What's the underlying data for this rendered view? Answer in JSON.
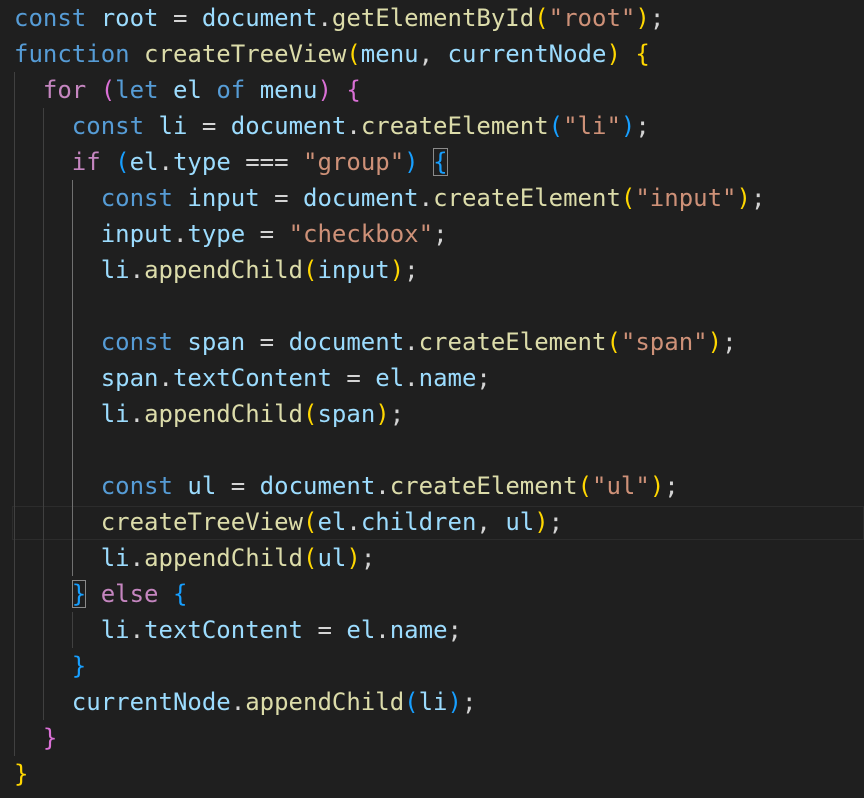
{
  "editor": {
    "language": "javascript",
    "colors": {
      "background": "#1f1f1f",
      "keyword": "#569cd6",
      "control": "#c586c0",
      "variable": "#9cdcfe",
      "function": "#dcdcaa",
      "string": "#ce9178",
      "plain": "#d4d4d4",
      "bracket_level_1": "#ffd700",
      "bracket_level_2": "#da70d6",
      "bracket_level_3": "#179fff"
    },
    "highlighted_line": 15,
    "lines": [
      {
        "tokens": [
          {
            "t": "const",
            "c": "keyword"
          },
          {
            "t": " ",
            "c": "plain"
          },
          {
            "t": "root",
            "c": "variable"
          },
          {
            "t": " = ",
            "c": "plain"
          },
          {
            "t": "document",
            "c": "variable"
          },
          {
            "t": ".",
            "c": "plain"
          },
          {
            "t": "getElementById",
            "c": "function"
          },
          {
            "t": "(",
            "c": "bracket_level_1"
          },
          {
            "t": "\"root\"",
            "c": "string"
          },
          {
            "t": ")",
            "c": "bracket_level_1"
          },
          {
            "t": ";",
            "c": "plain"
          }
        ]
      },
      {
        "tokens": [
          {
            "t": "function",
            "c": "keyword"
          },
          {
            "t": " ",
            "c": "plain"
          },
          {
            "t": "createTreeView",
            "c": "function"
          },
          {
            "t": "(",
            "c": "bracket_level_1"
          },
          {
            "t": "menu",
            "c": "variable"
          },
          {
            "t": ", ",
            "c": "plain"
          },
          {
            "t": "currentNode",
            "c": "variable"
          },
          {
            "t": ")",
            "c": "bracket_level_1"
          },
          {
            "t": " ",
            "c": "plain"
          },
          {
            "t": "{",
            "c": "bracket_level_1"
          }
        ]
      },
      {
        "tokens": [
          {
            "t": "  ",
            "c": "plain"
          },
          {
            "t": "for",
            "c": "control"
          },
          {
            "t": " ",
            "c": "plain"
          },
          {
            "t": "(",
            "c": "bracket_level_2"
          },
          {
            "t": "let",
            "c": "keyword"
          },
          {
            "t": " ",
            "c": "plain"
          },
          {
            "t": "el",
            "c": "variable"
          },
          {
            "t": " ",
            "c": "plain"
          },
          {
            "t": "of",
            "c": "keyword"
          },
          {
            "t": " ",
            "c": "plain"
          },
          {
            "t": "menu",
            "c": "variable"
          },
          {
            "t": ")",
            "c": "bracket_level_2"
          },
          {
            "t": " ",
            "c": "plain"
          },
          {
            "t": "{",
            "c": "bracket_level_2"
          }
        ]
      },
      {
        "tokens": [
          {
            "t": "    ",
            "c": "plain"
          },
          {
            "t": "const",
            "c": "keyword"
          },
          {
            "t": " ",
            "c": "plain"
          },
          {
            "t": "li",
            "c": "variable"
          },
          {
            "t": " = ",
            "c": "plain"
          },
          {
            "t": "document",
            "c": "variable"
          },
          {
            "t": ".",
            "c": "plain"
          },
          {
            "t": "createElement",
            "c": "function"
          },
          {
            "t": "(",
            "c": "bracket_level_3"
          },
          {
            "t": "\"li\"",
            "c": "string"
          },
          {
            "t": ")",
            "c": "bracket_level_3"
          },
          {
            "t": ";",
            "c": "plain"
          }
        ]
      },
      {
        "tokens": [
          {
            "t": "    ",
            "c": "plain"
          },
          {
            "t": "if",
            "c": "control"
          },
          {
            "t": " ",
            "c": "plain"
          },
          {
            "t": "(",
            "c": "bracket_level_3"
          },
          {
            "t": "el",
            "c": "variable"
          },
          {
            "t": ".",
            "c": "plain"
          },
          {
            "t": "type",
            "c": "variable"
          },
          {
            "t": " === ",
            "c": "plain"
          },
          {
            "t": "\"group\"",
            "c": "string"
          },
          {
            "t": ")",
            "c": "bracket_level_3"
          },
          {
            "t": " ",
            "c": "plain"
          },
          {
            "t": "{",
            "c": "bracket_level_3",
            "box": true
          }
        ]
      },
      {
        "tokens": [
          {
            "t": "      ",
            "c": "plain"
          },
          {
            "t": "const",
            "c": "keyword"
          },
          {
            "t": " ",
            "c": "plain"
          },
          {
            "t": "input",
            "c": "variable"
          },
          {
            "t": " = ",
            "c": "plain"
          },
          {
            "t": "document",
            "c": "variable"
          },
          {
            "t": ".",
            "c": "plain"
          },
          {
            "t": "createElement",
            "c": "function"
          },
          {
            "t": "(",
            "c": "bracket_level_1"
          },
          {
            "t": "\"input\"",
            "c": "string"
          },
          {
            "t": ")",
            "c": "bracket_level_1"
          },
          {
            "t": ";",
            "c": "plain"
          }
        ]
      },
      {
        "tokens": [
          {
            "t": "      ",
            "c": "plain"
          },
          {
            "t": "input",
            "c": "variable"
          },
          {
            "t": ".",
            "c": "plain"
          },
          {
            "t": "type",
            "c": "variable"
          },
          {
            "t": " = ",
            "c": "plain"
          },
          {
            "t": "\"checkbox\"",
            "c": "string"
          },
          {
            "t": ";",
            "c": "plain"
          }
        ]
      },
      {
        "tokens": [
          {
            "t": "      ",
            "c": "plain"
          },
          {
            "t": "li",
            "c": "variable"
          },
          {
            "t": ".",
            "c": "plain"
          },
          {
            "t": "appendChild",
            "c": "function"
          },
          {
            "t": "(",
            "c": "bracket_level_1"
          },
          {
            "t": "input",
            "c": "variable"
          },
          {
            "t": ")",
            "c": "bracket_level_1"
          },
          {
            "t": ";",
            "c": "plain"
          }
        ]
      },
      {
        "tokens": []
      },
      {
        "tokens": [
          {
            "t": "      ",
            "c": "plain"
          },
          {
            "t": "const",
            "c": "keyword"
          },
          {
            "t": " ",
            "c": "plain"
          },
          {
            "t": "span",
            "c": "variable"
          },
          {
            "t": " = ",
            "c": "plain"
          },
          {
            "t": "document",
            "c": "variable"
          },
          {
            "t": ".",
            "c": "plain"
          },
          {
            "t": "createElement",
            "c": "function"
          },
          {
            "t": "(",
            "c": "bracket_level_1"
          },
          {
            "t": "\"span\"",
            "c": "string"
          },
          {
            "t": ")",
            "c": "bracket_level_1"
          },
          {
            "t": ";",
            "c": "plain"
          }
        ]
      },
      {
        "tokens": [
          {
            "t": "      ",
            "c": "plain"
          },
          {
            "t": "span",
            "c": "variable"
          },
          {
            "t": ".",
            "c": "plain"
          },
          {
            "t": "textContent",
            "c": "variable"
          },
          {
            "t": " = ",
            "c": "plain"
          },
          {
            "t": "el",
            "c": "variable"
          },
          {
            "t": ".",
            "c": "plain"
          },
          {
            "t": "name",
            "c": "variable"
          },
          {
            "t": ";",
            "c": "plain"
          }
        ]
      },
      {
        "tokens": [
          {
            "t": "      ",
            "c": "plain"
          },
          {
            "t": "li",
            "c": "variable"
          },
          {
            "t": ".",
            "c": "plain"
          },
          {
            "t": "appendChild",
            "c": "function"
          },
          {
            "t": "(",
            "c": "bracket_level_1"
          },
          {
            "t": "span",
            "c": "variable"
          },
          {
            "t": ")",
            "c": "bracket_level_1"
          },
          {
            "t": ";",
            "c": "plain"
          }
        ]
      },
      {
        "tokens": []
      },
      {
        "tokens": [
          {
            "t": "      ",
            "c": "plain"
          },
          {
            "t": "const",
            "c": "keyword"
          },
          {
            "t": " ",
            "c": "plain"
          },
          {
            "t": "ul",
            "c": "variable"
          },
          {
            "t": " = ",
            "c": "plain"
          },
          {
            "t": "document",
            "c": "variable"
          },
          {
            "t": ".",
            "c": "plain"
          },
          {
            "t": "createElement",
            "c": "function"
          },
          {
            "t": "(",
            "c": "bracket_level_1"
          },
          {
            "t": "\"ul\"",
            "c": "string"
          },
          {
            "t": ")",
            "c": "bracket_level_1"
          },
          {
            "t": ";",
            "c": "plain"
          }
        ]
      },
      {
        "tokens": [
          {
            "t": "      ",
            "c": "plain"
          },
          {
            "t": "createTreeView",
            "c": "function"
          },
          {
            "t": "(",
            "c": "bracket_level_1"
          },
          {
            "t": "el",
            "c": "variable"
          },
          {
            "t": ".",
            "c": "plain"
          },
          {
            "t": "children",
            "c": "variable"
          },
          {
            "t": ", ",
            "c": "plain"
          },
          {
            "t": "ul",
            "c": "variable"
          },
          {
            "t": ")",
            "c": "bracket_level_1"
          },
          {
            "t": ";",
            "c": "plain"
          }
        ]
      },
      {
        "tokens": [
          {
            "t": "      ",
            "c": "plain"
          },
          {
            "t": "li",
            "c": "variable"
          },
          {
            "t": ".",
            "c": "plain"
          },
          {
            "t": "appendChild",
            "c": "function"
          },
          {
            "t": "(",
            "c": "bracket_level_1"
          },
          {
            "t": "ul",
            "c": "variable"
          },
          {
            "t": ")",
            "c": "bracket_level_1"
          },
          {
            "t": ";",
            "c": "plain"
          }
        ]
      },
      {
        "tokens": [
          {
            "t": "    ",
            "c": "plain"
          },
          {
            "t": "}",
            "c": "bracket_level_3",
            "box": true
          },
          {
            "t": " ",
            "c": "plain"
          },
          {
            "t": "else",
            "c": "control"
          },
          {
            "t": " ",
            "c": "plain"
          },
          {
            "t": "{",
            "c": "bracket_level_3"
          }
        ]
      },
      {
        "tokens": [
          {
            "t": "      ",
            "c": "plain"
          },
          {
            "t": "li",
            "c": "variable"
          },
          {
            "t": ".",
            "c": "plain"
          },
          {
            "t": "textContent",
            "c": "variable"
          },
          {
            "t": " = ",
            "c": "plain"
          },
          {
            "t": "el",
            "c": "variable"
          },
          {
            "t": ".",
            "c": "plain"
          },
          {
            "t": "name",
            "c": "variable"
          },
          {
            "t": ";",
            "c": "plain"
          }
        ]
      },
      {
        "tokens": [
          {
            "t": "    ",
            "c": "plain"
          },
          {
            "t": "}",
            "c": "bracket_level_3"
          }
        ]
      },
      {
        "tokens": [
          {
            "t": "    ",
            "c": "plain"
          },
          {
            "t": "currentNode",
            "c": "variable"
          },
          {
            "t": ".",
            "c": "plain"
          },
          {
            "t": "appendChild",
            "c": "function"
          },
          {
            "t": "(",
            "c": "bracket_level_3"
          },
          {
            "t": "li",
            "c": "variable"
          },
          {
            "t": ")",
            "c": "bracket_level_3"
          },
          {
            "t": ";",
            "c": "plain"
          }
        ]
      },
      {
        "tokens": [
          {
            "t": "  ",
            "c": "plain"
          },
          {
            "t": "}",
            "c": "bracket_level_2"
          }
        ]
      },
      {
        "tokens": [
          {
            "t": "}",
            "c": "bracket_level_1"
          }
        ]
      }
    ]
  }
}
